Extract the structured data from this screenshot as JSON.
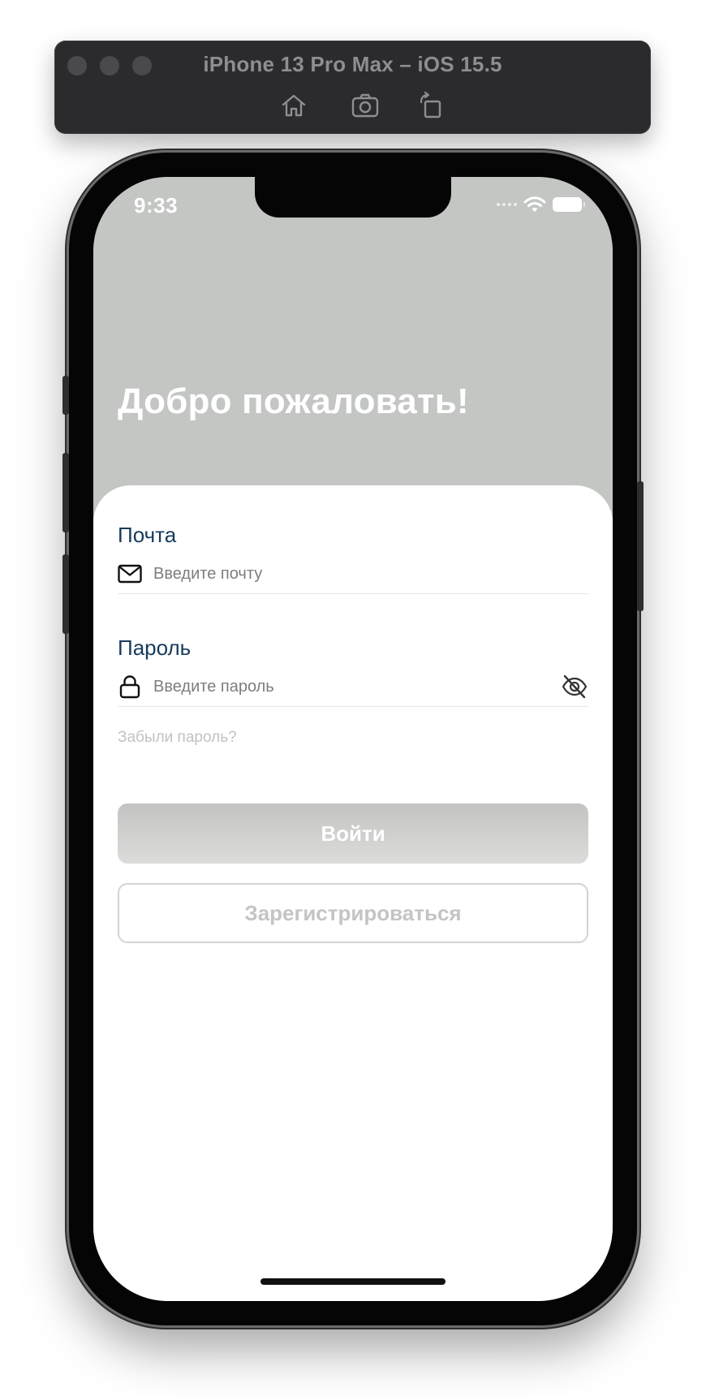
{
  "simulator": {
    "title": "iPhone 13 Pro Max – iOS 15.5",
    "buttons": [
      "home-icon",
      "screenshot-icon",
      "rotate-icon"
    ]
  },
  "status_bar": {
    "time": "9:33",
    "icons": [
      "cellular-icon",
      "wifi-icon",
      "battery-icon"
    ]
  },
  "header": {
    "title": "Добро пожаловать!",
    "background": "#c3c6c3"
  },
  "form": {
    "email": {
      "label": "Почта",
      "placeholder": "Введите почту",
      "icon": "mail-icon"
    },
    "password": {
      "label": "Пароль",
      "placeholder": "Введите пароль",
      "icon": "lock-icon",
      "toggle_icon": "eye-slash-icon"
    },
    "forgot_link": "Забыли пароль?",
    "login_button": "Войти",
    "register_button": "Зарегистрироваться"
  },
  "colors": {
    "label": "#173a5c",
    "muted": "#c2c2c2"
  }
}
